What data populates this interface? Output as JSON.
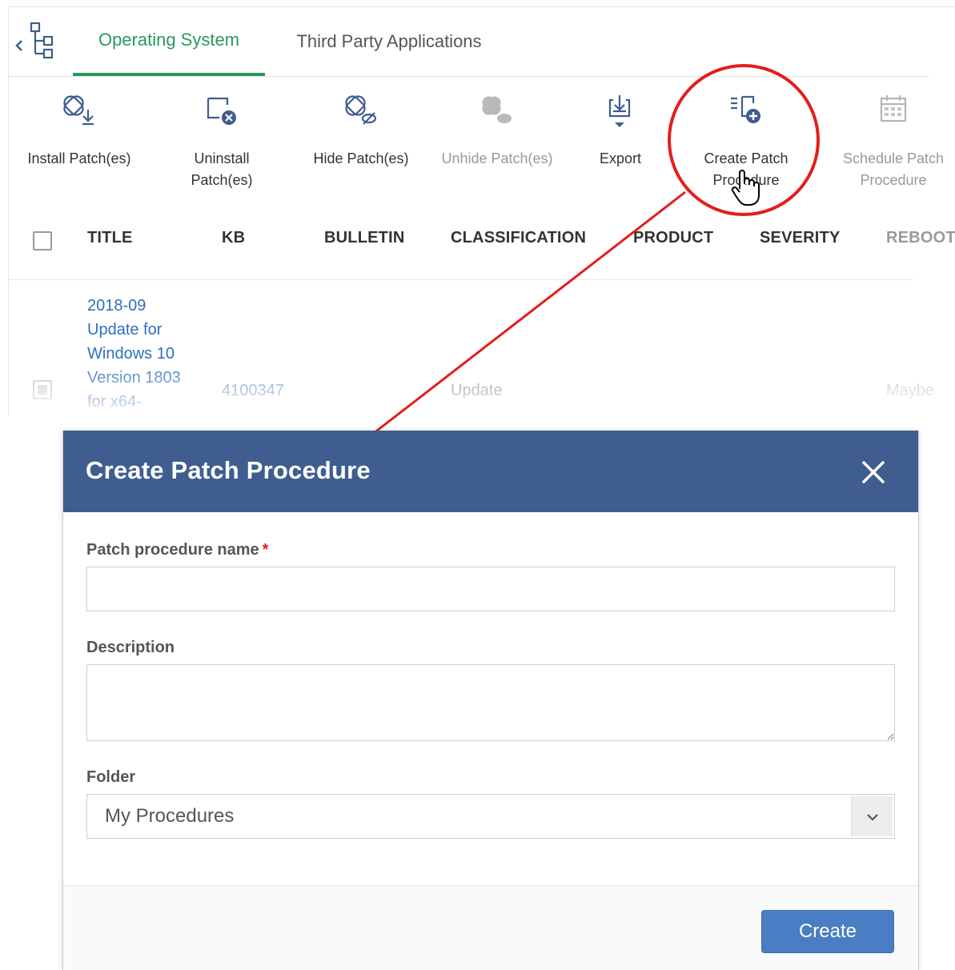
{
  "tabs": [
    {
      "label": "Operating System",
      "active": true
    },
    {
      "label": "Third Party Applications",
      "active": false
    }
  ],
  "toolbar": {
    "install": "Install Patch(es)",
    "uninstall_1": "Uninstall",
    "uninstall_2": "Patch(es)",
    "hide": "Hide Patch(es)",
    "unhide": "Unhide Patch(es)",
    "export": "Export",
    "create_1": "Create Patch",
    "create_2": "Procedure",
    "schedule_1": "Schedule Patch",
    "schedule_2": "Procedure"
  },
  "table": {
    "headers": [
      "TITLE",
      "KB",
      "BULLETIN",
      "CLASSIFICATION",
      "PRODUCT",
      "SEVERITY",
      "REBOOT"
    ],
    "row": {
      "title_lines": [
        "2018-09",
        "Update for",
        "Windows 10",
        "Version 1803",
        "for x64-"
      ],
      "kb": "4100347",
      "classification": "Update",
      "reboot": "Maybe"
    }
  },
  "dialog": {
    "title": "Create Patch Procedure",
    "name_label": "Patch procedure name",
    "required_mark": "*",
    "name_value": "",
    "description_label": "Description",
    "description_value": "",
    "folder_label": "Folder",
    "folder_value": "My Procedures",
    "create_button": "Create"
  },
  "colors": {
    "active_tab": "#2a9a5c",
    "dialog_header": "#3f5d8f",
    "primary_button": "#4a7ec4",
    "link": "#2d6fbf",
    "annotation": "#e21d1d"
  }
}
